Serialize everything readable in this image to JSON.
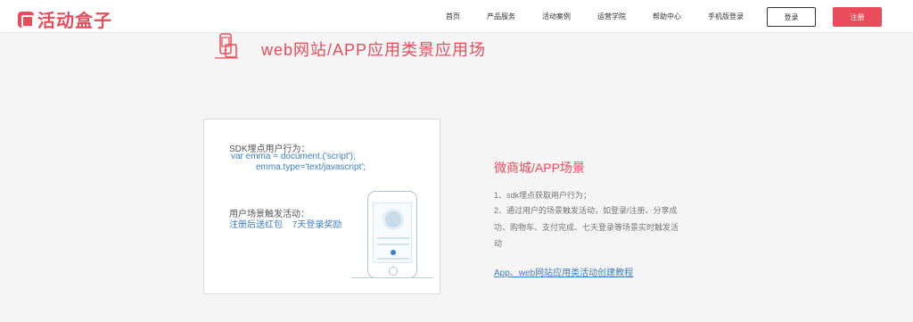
{
  "brand": {
    "name": "活动盒子",
    "accent_color": "#e84c5b",
    "link_color": "#3b7fc4"
  },
  "nav": {
    "items": [
      "首页",
      "产品服务",
      "活动案例",
      "运营学院",
      "帮助中心",
      "手机版登录"
    ]
  },
  "actions": {
    "login_label": "登录",
    "register_label": "注册"
  },
  "section": {
    "icon": "phone-web-icon",
    "title": "web网站/APP应用类景应用场"
  },
  "demo_card": {
    "code_title": "SDK埋点用户行为：",
    "code_line1": "var emma = document.('script');",
    "code_line2": "emma.type='text/javascript';",
    "trigger_title": "用户场景触发活动：",
    "trigger_items": [
      "注册后送红包",
      "7天登录奖励"
    ],
    "illustration": "phone-illustration"
  },
  "scene": {
    "title": "微商城/APP场景",
    "lines": [
      "1、sdk埋点获取用户行为；",
      "2、通过用户的场景触发活动，如登录/注册、分享成",
      "功、购物车、支付完成、七天登录等场景实时触发活",
      "动"
    ],
    "link_text": "App、web网站应用类活动创建教程"
  }
}
